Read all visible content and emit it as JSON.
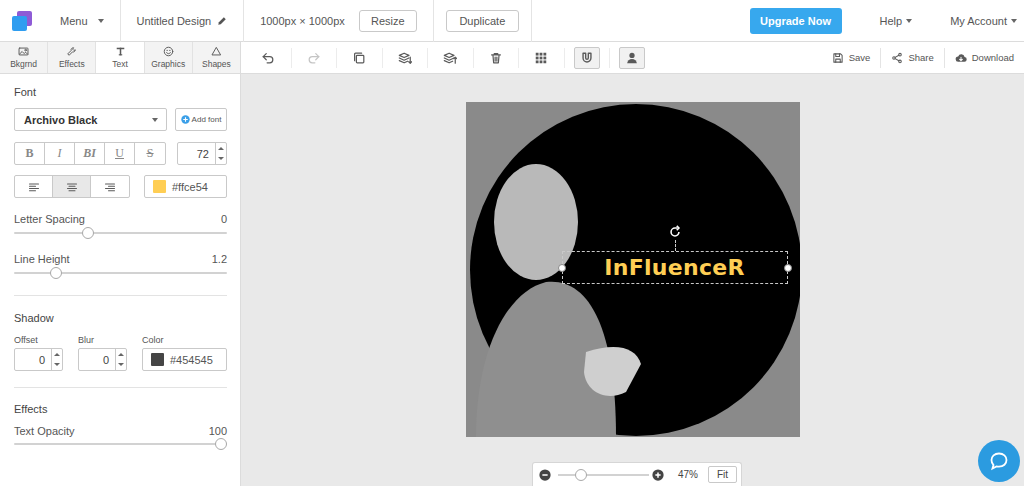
{
  "topbar": {
    "menu": "Menu",
    "title": "Untitled Design",
    "size": "1000px × 1000px",
    "resize": "Resize",
    "duplicate": "Duplicate",
    "upgrade": "Upgrade Now",
    "help": "Help",
    "account": "My Account"
  },
  "panel_tabs": [
    {
      "label": "Bkgrnd",
      "kind": "image",
      "selected": false
    },
    {
      "label": "Effects",
      "kind": "wrench",
      "selected": false
    },
    {
      "label": "Text",
      "kind": "text",
      "selected": true
    },
    {
      "label": "Graphics",
      "kind": "smiley",
      "selected": false
    },
    {
      "label": "Shapes",
      "kind": "triangle",
      "selected": false
    }
  ],
  "toolbar": {
    "tools": [
      {
        "kind": "undo",
        "disabled": false,
        "on": false
      },
      {
        "kind": "redo",
        "disabled": true,
        "on": false
      },
      {
        "kind": "copy",
        "disabled": false,
        "on": false
      },
      {
        "kind": "layerdown",
        "disabled": false,
        "on": false
      },
      {
        "kind": "layerup",
        "disabled": false,
        "on": false
      },
      {
        "kind": "trash",
        "disabled": false,
        "on": false
      },
      {
        "kind": "grid",
        "disabled": false,
        "on": false
      },
      {
        "kind": "magnet",
        "disabled": false,
        "on": true
      },
      {
        "kind": "person",
        "disabled": false,
        "on": true
      }
    ],
    "actions": [
      {
        "label": "Save",
        "kind": "save"
      },
      {
        "label": "Share",
        "kind": "share"
      },
      {
        "label": "Download",
        "kind": "download"
      }
    ]
  },
  "font": {
    "section": "Font",
    "family": "Archivo Black",
    "add_font": "Add font",
    "styles": [
      {
        "label": "B",
        "kind": "bold",
        "selected": false
      },
      {
        "label": "I",
        "kind": "italic",
        "selected": false
      },
      {
        "label": "BI",
        "kind": "bolditalic",
        "selected": false
      },
      {
        "label": "U",
        "kind": "underline",
        "selected": false
      },
      {
        "label": "S",
        "kind": "strike",
        "selected": false
      }
    ],
    "size": "72",
    "align": [
      {
        "kind": "left",
        "selected": false
      },
      {
        "kind": "center",
        "selected": true
      },
      {
        "kind": "right",
        "selected": false
      }
    ],
    "color": "#ffce54"
  },
  "letter_spacing": {
    "label": "Letter Spacing",
    "value": "0",
    "level": 0.34
  },
  "line_height": {
    "label": "Line Height",
    "value": "1.2",
    "level": 0.18
  },
  "shadow": {
    "section": "Shadow",
    "offset_label": "Offset",
    "offset": "0",
    "blur_label": "Blur",
    "blur": "0",
    "color_label": "Color",
    "color": "#454545"
  },
  "effects": {
    "section": "Effects",
    "opacity_label": "Text Opacity",
    "opacity": "100",
    "level": 1.0
  },
  "canvas": {
    "text": "InFluenceR",
    "selected": true
  },
  "zoom": {
    "value": "47%",
    "level": 0.22,
    "fit": "Fit"
  }
}
